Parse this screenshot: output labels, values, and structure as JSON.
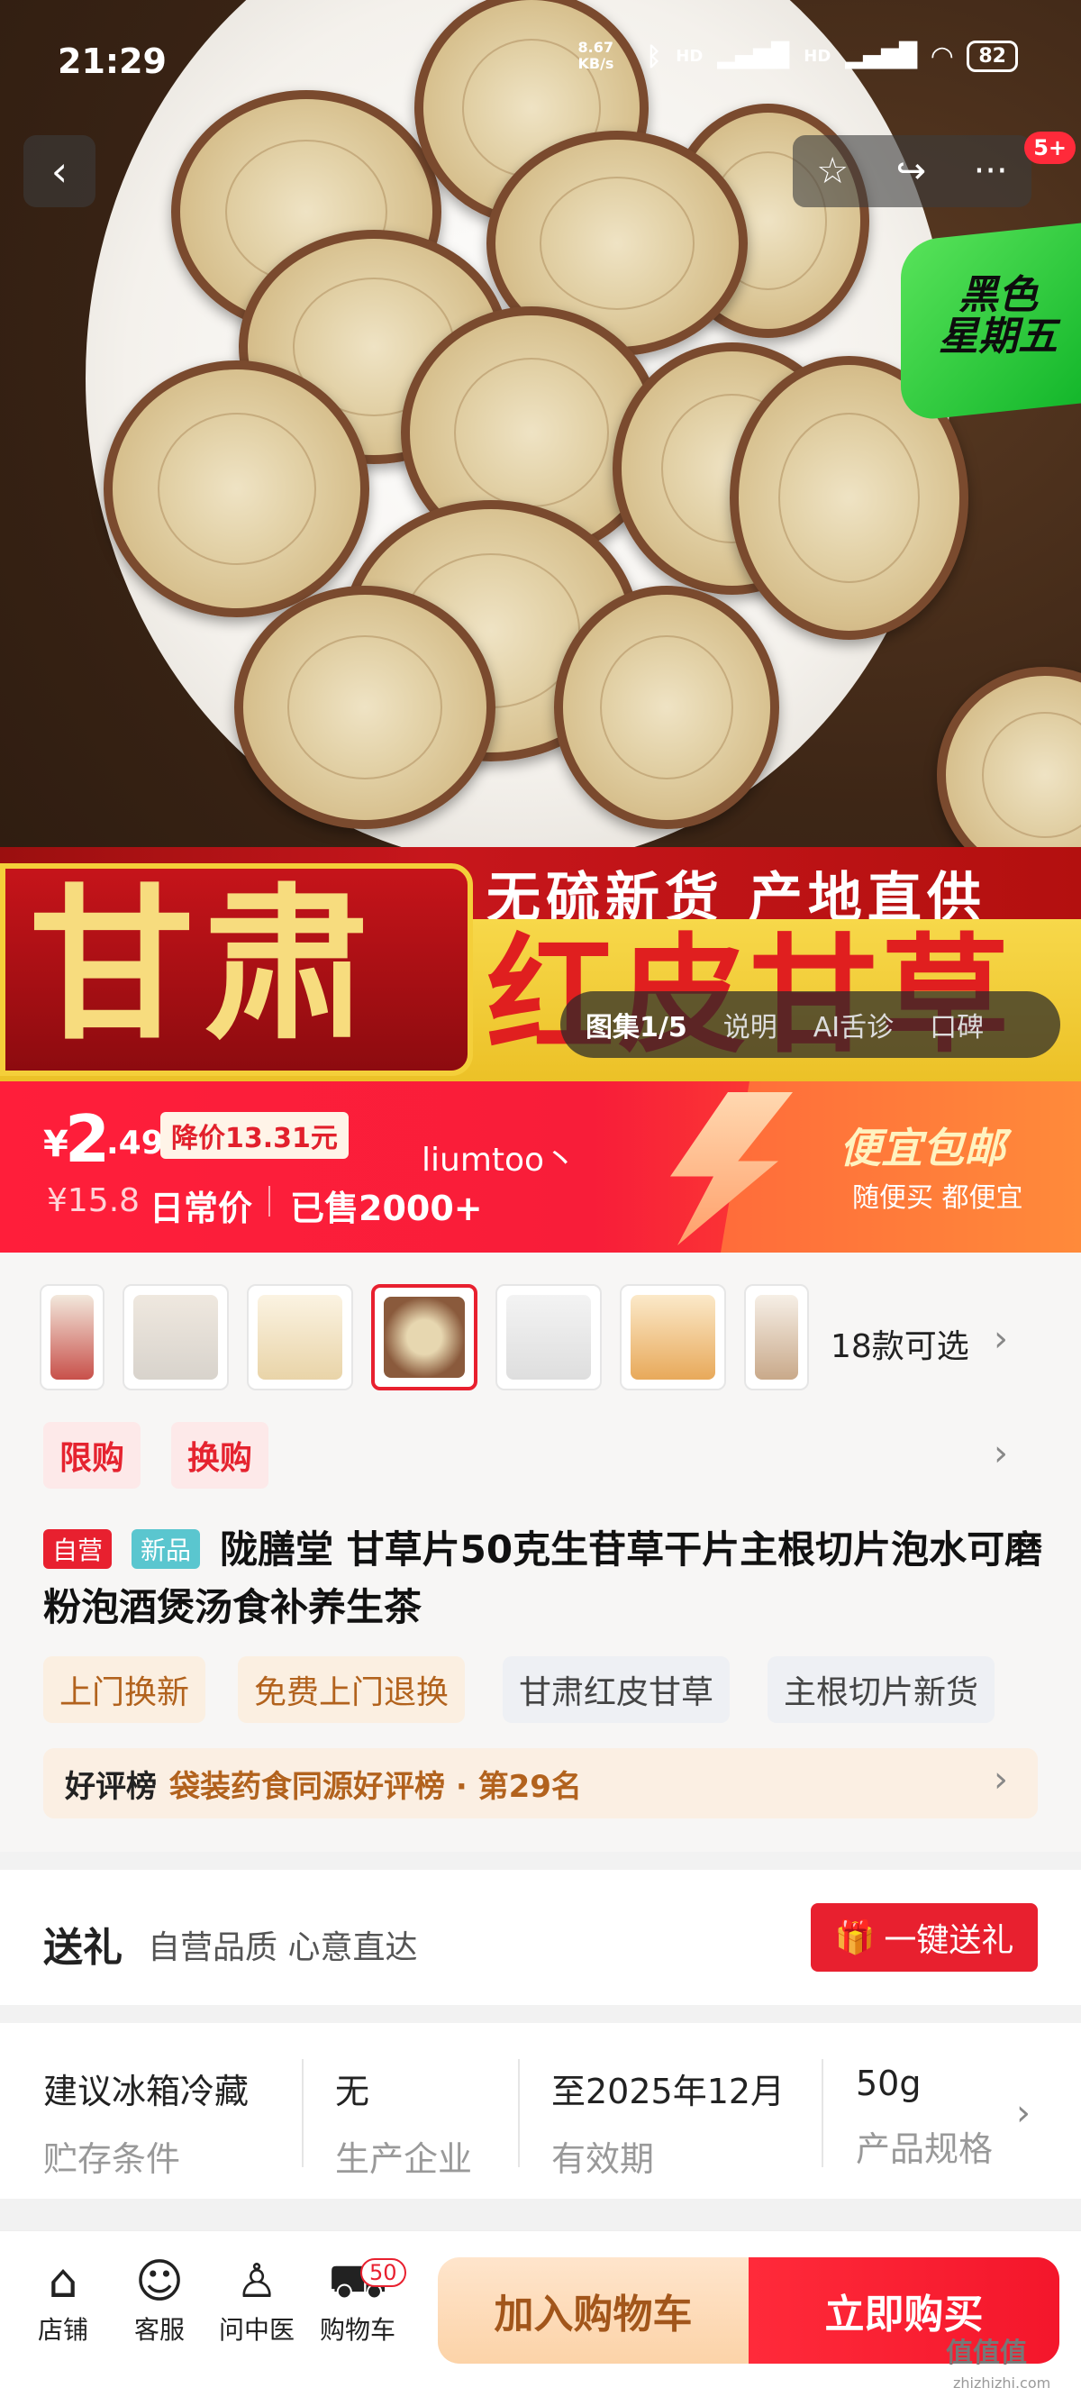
{
  "status_bar": {
    "time": "21:29",
    "net_speed": "8.67 KB/s",
    "signal_1": "HD",
    "signal_2": "HD",
    "battery": "82"
  },
  "nav": {
    "notification_badge": "5+"
  },
  "hero": {
    "black_friday_line1": "黑色",
    "black_friday_line2": "星期五",
    "banner_top": "无硫新货 产地直供",
    "banner_left": "甘肃",
    "banner_right": "红皮甘草"
  },
  "gallery_tabs": [
    "图集1/5",
    "说明",
    "AI舌诊",
    "口碑"
  ],
  "price": {
    "currency": "¥",
    "integer": "2",
    "decimal": ".49",
    "price_cut": "降价13.31元",
    "user_tag": "liumtoo丶",
    "original_price": "¥15.8",
    "daily_label": "日常价",
    "sold": "已售2000+",
    "free_ship": "便宜包邮",
    "free_ship_sub": "随便买 都便宜"
  },
  "sku": {
    "count_label": "18款可选"
  },
  "promo_tags": [
    "限购",
    "换购"
  ],
  "product": {
    "self_tag": "自营",
    "new_tag": "新品",
    "title": "陇膳堂 甘草片50克生苷草干片主根切片泡水可磨粉泡酒煲汤食补养生茶"
  },
  "services": [
    "上门换新",
    "免费上门退换",
    "甘肃红皮甘草",
    "主根切片新货"
  ],
  "ranking": {
    "label": "好评榜",
    "text": "袋装药食同源好评榜 · 第29名"
  },
  "gift": {
    "title": "送礼",
    "subtitle": "自营品质 心意直达",
    "button": "一键送礼"
  },
  "specs": [
    {
      "value": "建议冰箱冷藏",
      "label": "贮存条件"
    },
    {
      "value": "无",
      "label": "生产企业"
    },
    {
      "value": "至2025年12月",
      "label": "有效期"
    },
    {
      "value": "50g",
      "label": "产品规格"
    }
  ],
  "bottom_nav": [
    {
      "label": "店铺",
      "icon": "store-icon"
    },
    {
      "label": "客服",
      "icon": "service-icon"
    },
    {
      "label": "问中医",
      "icon": "doctor-icon"
    },
    {
      "label": "购物车",
      "icon": "cart-icon"
    }
  ],
  "cart_badge": "50",
  "actions": {
    "add_to_cart": "加入购物车",
    "buy_now": "立即购买"
  },
  "watermark": {
    "text": "值值值",
    "domain": "zhizhizhi.com"
  },
  "colors": {
    "accent_red": "#e8202f",
    "price_red": "#ff1e3a",
    "promo_orange": "#ff6c3a",
    "black_friday_green": "#14b72b"
  }
}
